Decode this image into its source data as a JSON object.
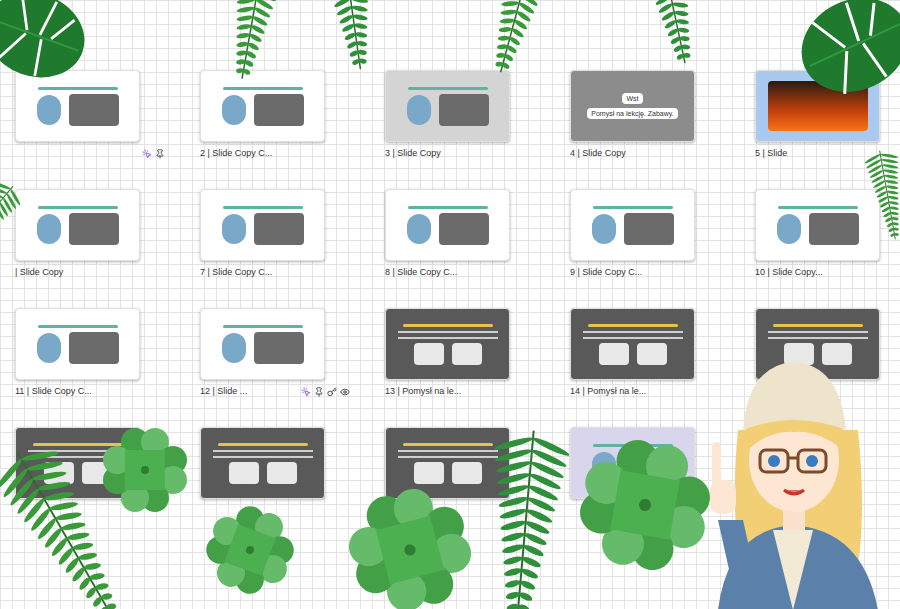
{
  "slides": [
    {
      "kind": "light",
      "color": "#ffffff",
      "tools": [
        "interactive",
        "pin"
      ]
    },
    {
      "kind": "light",
      "color": "#ffffff",
      "label": "2 | Slide Copy C..."
    },
    {
      "kind": "light",
      "color": "#d4d4d4",
      "label": "3 | Slide Copy"
    },
    {
      "kind": "boxes",
      "color": "#8c8c8c",
      "label": "4 | Slide Copy",
      "texts": [
        "Wst",
        "Pomysł na lekcję. Zabawy."
      ]
    },
    {
      "kind": "photo",
      "color": "#a9c9ef",
      "label": "5 | Slide"
    },
    {
      "kind": "light",
      "color": "#ffffff",
      "label": "| Slide Copy"
    },
    {
      "kind": "light",
      "color": "#ffffff",
      "label": "7 | Slide Copy C..."
    },
    {
      "kind": "light",
      "color": "#ffffff",
      "label": "8 | Slide Copy C..."
    },
    {
      "kind": "light",
      "color": "#ffffff",
      "label": "9 | Slide Copy C..."
    },
    {
      "kind": "light",
      "color": "#ffffff",
      "label": "10 | Slide Copy..."
    },
    {
      "kind": "light",
      "color": "#ffffff",
      "label": "11 | Slide Copy C..."
    },
    {
      "kind": "light",
      "color": "#ffffff",
      "label": "12 | Slide ...",
      "tools": [
        "interactive",
        "pin",
        "key",
        "eye"
      ]
    },
    {
      "kind": "dark",
      "color": "#595959",
      "label": "13 | Pomysł na le..."
    },
    {
      "kind": "dark",
      "color": "#595959",
      "label": "14 | Pomysł na le..."
    },
    {
      "kind": "dark",
      "color": "#595959"
    },
    {
      "kind": "dark",
      "color": "#595959"
    },
    {
      "kind": "dark",
      "color": "#595959"
    },
    {
      "kind": "dark",
      "color": "#595959"
    },
    {
      "kind": "light",
      "color": "#d9d5ec"
    }
  ]
}
